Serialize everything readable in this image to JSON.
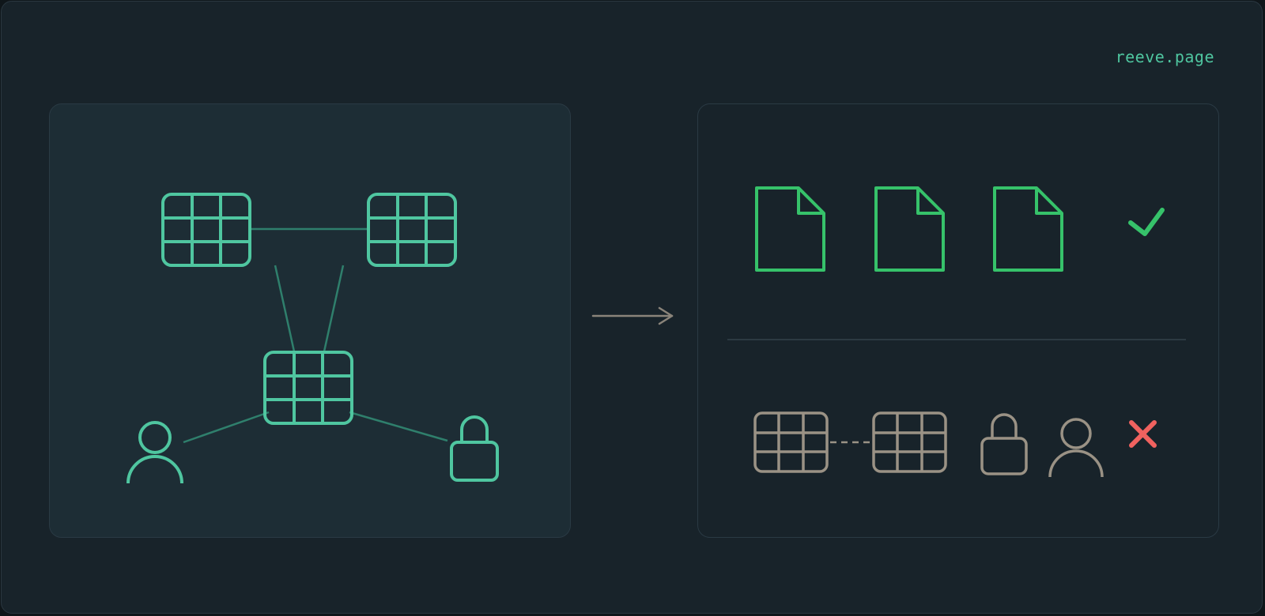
{
  "brand": {
    "text": "reeve.page"
  },
  "colors": {
    "background": "#18232a",
    "frame_border": "#2a3740",
    "left_panel_fill": "#1d2d35",
    "panel_border": "#2a3a44",
    "teal": "#4fc6a0",
    "teal_line": "#2f7f6c",
    "green": "#36c26a",
    "gray": "#9a9285",
    "red": "#f0625f",
    "divider": "#2c3a42"
  },
  "icons": {
    "left_panel": [
      "table-icon",
      "table-icon",
      "table-icon",
      "user-icon",
      "lock-icon"
    ],
    "arrow": "arrow-right-icon",
    "right_top_row": [
      "document-icon",
      "document-icon",
      "document-icon",
      "checkmark-icon"
    ],
    "right_bottom_row": [
      "table-icon",
      "table-icon",
      "lock-icon",
      "user-icon",
      "cross-icon"
    ]
  }
}
